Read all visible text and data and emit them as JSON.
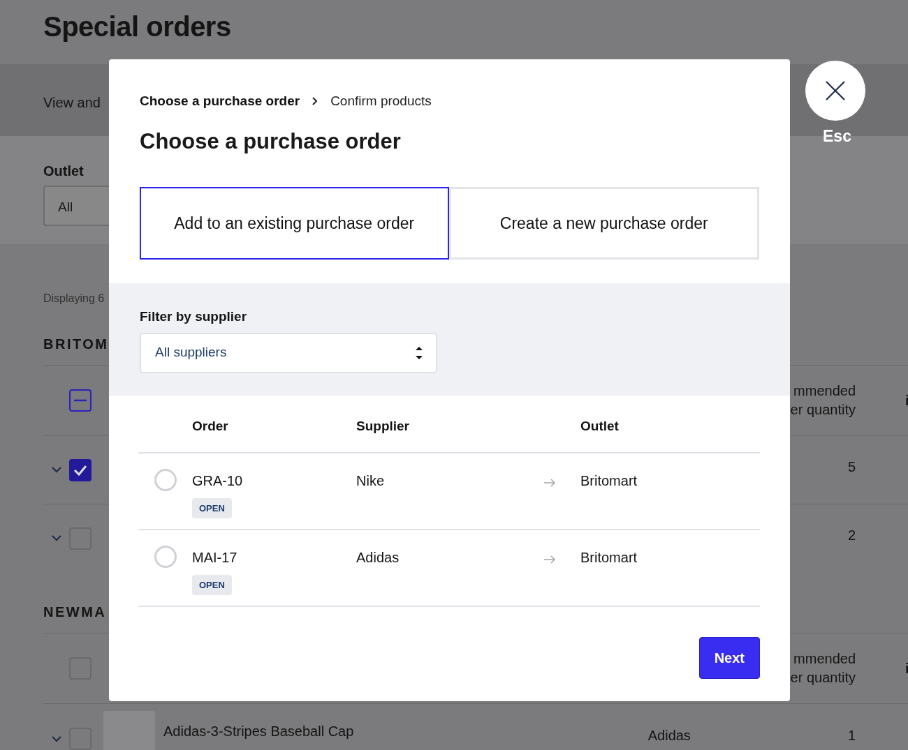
{
  "page": {
    "title": "Special orders",
    "subtitle": "View and",
    "outlet_filter": {
      "label": "Outlet",
      "value": "All"
    },
    "summary": "Displaying 6",
    "groups": [
      {
        "name": "BRITOM",
        "header": {
          "indeterminate": true,
          "column_heading": "mmended\ner quantity",
          "column_heading_2": "i"
        },
        "rows": [
          {
            "checked": true,
            "quantity": "5"
          },
          {
            "checked": false,
            "quantity": "2"
          }
        ]
      },
      {
        "name": "NEWMA",
        "header": {
          "indeterminate": false,
          "column_heading": "mmended\ner quantity",
          "column_heading_2": "i"
        },
        "rows": [
          {
            "checked": false,
            "name": "Adidas-3-Stripes Baseball Cap",
            "supplier": "Adidas",
            "quantity": "1"
          }
        ]
      }
    ]
  },
  "dialog": {
    "breadcrumb": [
      {
        "label": "Choose a purchase order",
        "selected": true
      },
      {
        "label": "Confirm products",
        "selected": false
      }
    ],
    "title": "Choose a purchase order",
    "options": [
      {
        "label": "Add to an existing purchase order",
        "selected": true
      },
      {
        "label": "Create a new purchase order",
        "selected": false
      }
    ],
    "filter": {
      "label": "Filter by supplier",
      "value": "All suppliers"
    },
    "table": {
      "columns": [
        "Order",
        "Supplier",
        "Outlet"
      ],
      "rows": [
        {
          "selected": false,
          "order": "GRA-10",
          "status": "OPEN",
          "supplier": "Nike",
          "outlet": "Britomart"
        },
        {
          "selected": false,
          "order": "MAI-17",
          "status": "OPEN",
          "supplier": "Adidas",
          "outlet": "Britomart"
        }
      ]
    },
    "next_button": "Next"
  },
  "close": {
    "label": "Esc"
  }
}
